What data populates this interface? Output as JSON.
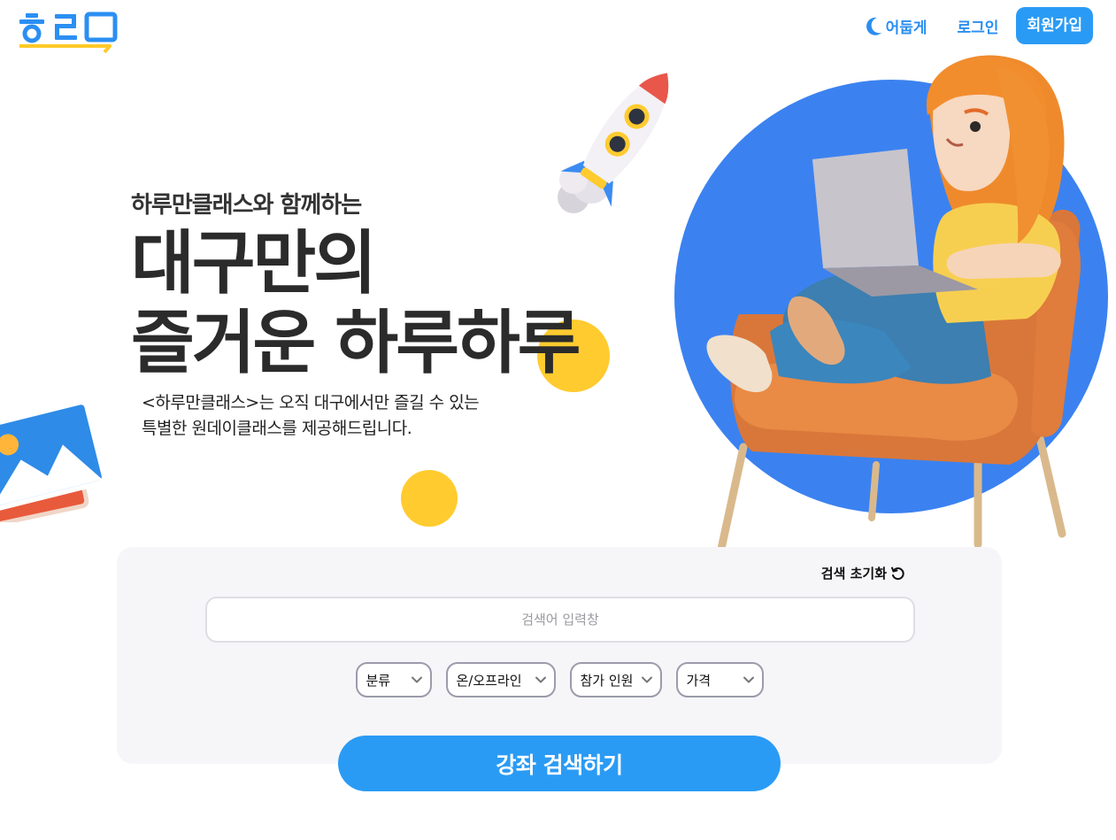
{
  "header": {
    "logo_text": "하루",
    "theme_toggle_label": "어둡게",
    "login_label": "로그인",
    "signup_label": "회원가입"
  },
  "hero": {
    "subtitle": "하루만클래스와 함께하는",
    "title_line1": "대구만의",
    "title_line2": "즐거운 하루하루",
    "description_line1": "<하루만클래스>는 오직 대구에서만 즐길 수 있는",
    "description_line2": "특별한 원데이클래스를 제공해드립니다."
  },
  "search": {
    "reset_label": "검색 초기화",
    "input_value": "",
    "input_placeholder": "검색어 입력창",
    "filters": [
      {
        "label": "분류"
      },
      {
        "label": "온/오프라인"
      },
      {
        "label": "참가 인원"
      },
      {
        "label": "가격"
      }
    ],
    "submit_label": "강좌 검색하기"
  },
  "colors": {
    "brand_blue": "#2a9bf5",
    "accent_yellow": "#ffcb2f",
    "circle_blue": "#3b82f0",
    "panel_bg": "#f6f6f9"
  },
  "icons": [
    "moon-icon",
    "refresh-icon",
    "chevron-down-icon"
  ]
}
